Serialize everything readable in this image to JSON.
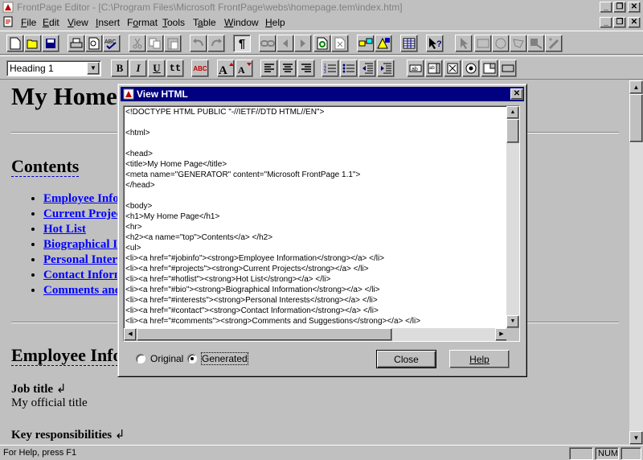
{
  "window": {
    "title": "FrontPage Editor - [C:\\Program Files\\Microsoft FrontPage\\webs\\homepage.tem\\index.htm]",
    "caption_buttons": [
      "minimize-icon",
      "restore-icon",
      "close-icon"
    ]
  },
  "menubar": {
    "items": [
      {
        "label": "File",
        "accel": "F"
      },
      {
        "label": "Edit",
        "accel": "E"
      },
      {
        "label": "View",
        "accel": "V"
      },
      {
        "label": "Insert",
        "accel": "I"
      },
      {
        "label": "Format",
        "accel": "o"
      },
      {
        "label": "Tools",
        "accel": "T"
      },
      {
        "label": "Table",
        "accel": "a"
      },
      {
        "label": "Window",
        "accel": "W"
      },
      {
        "label": "Help",
        "accel": "H"
      }
    ]
  },
  "toolbar_format": {
    "style_value": "Heading 1",
    "bold_label": "B",
    "italic_label": "I",
    "underline_label": "U",
    "typewriter_label": "tt",
    "spell_label": "ABC"
  },
  "document": {
    "heading1": "My Home Page",
    "contents_heading": "Contents",
    "toc_links": [
      "Employee Information",
      "Current Projects",
      "Hot List",
      "Biographical Information",
      "Personal Interests",
      "Contact Information",
      "Comments and Suggestions"
    ],
    "employee_heading": "Employee Information",
    "job_title_term": "Job title",
    "job_title_def": "My official title",
    "key_resp_term": "Key responsibilities",
    "line_break_mark": "↲"
  },
  "dialog": {
    "title": "View HTML",
    "source_lines": [
      "<!DOCTYPE HTML PUBLIC \"-//IETF//DTD HTML//EN\">",
      "",
      "<html>",
      "",
      "<head>",
      "<title>My Home Page</title>",
      "<meta name=\"GENERATOR\" content=\"Microsoft FrontPage 1.1\">",
      "</head>",
      "",
      "<body>",
      "<h1>My Home Page</h1>",
      "<hr>",
      "<h2><a name=\"top\">Contents</a> </h2>",
      "<ul>",
      "<li><a href=\"#jobinfo\"><strong>Employee Information</strong></a> </li>",
      "<li><a href=\"#projects\"><strong>Current Projects</strong></a> </li>",
      "<li><a href=\"#hotlist\"><strong>Hot List</strong></a> </li>",
      "<li><a href=\"#bio\"><strong>Biographical Information</strong></a> </li>",
      "<li><a href=\"#interests\"><strong>Personal Interests</strong></a> </li>",
      "<li><a href=\"#contact\"><strong>Contact Information</strong></a> </li>",
      "<li><a href=\"#comments\"><strong>Comments and Suggestions</strong></a> </li>"
    ],
    "radio_original": "Original",
    "radio_generated": "Generated",
    "selected_view": "Generated",
    "close_button": "Close",
    "help_button": "Help"
  },
  "statusbar": {
    "message": "For Help, press F1",
    "num_indicator": "NUM"
  }
}
